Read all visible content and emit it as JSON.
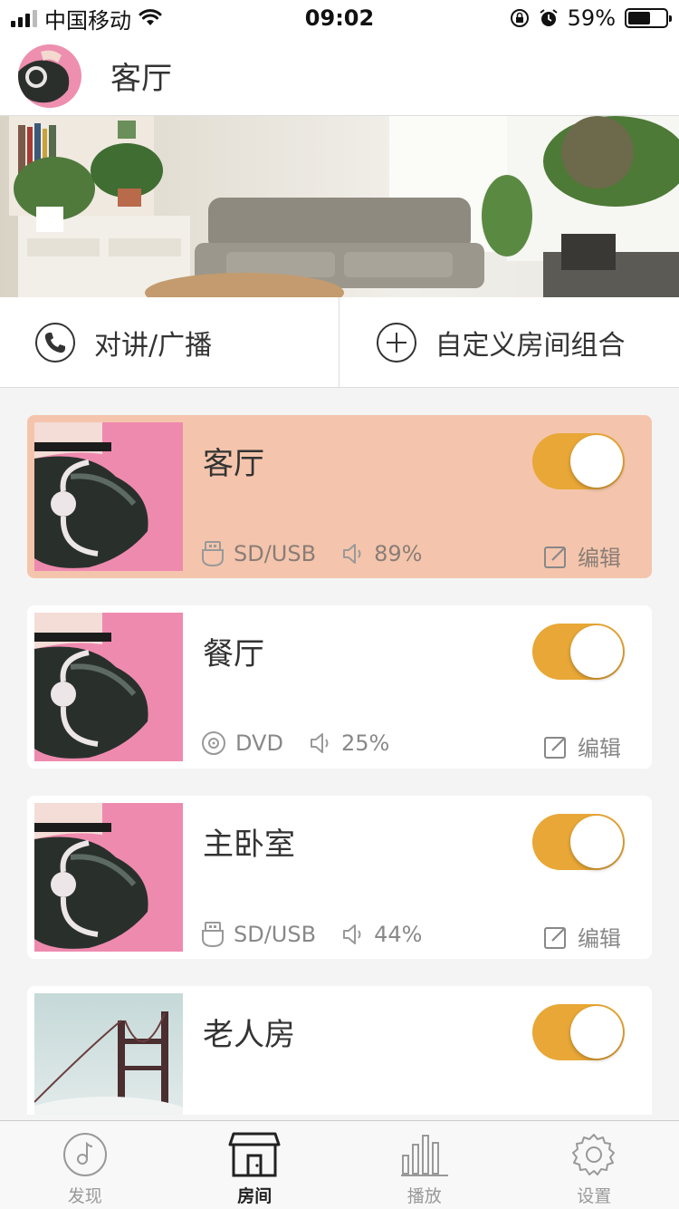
{
  "status_bar": {
    "carrier": "中国移动",
    "time": "09:02",
    "battery_percent": "59%"
  },
  "header": {
    "title": "客厅"
  },
  "actions": {
    "intercom_label": "对讲/广播",
    "custom_group_label": "自定义房间组合"
  },
  "rooms": [
    {
      "name": "客厅",
      "source": "SD/USB",
      "source_icon": "usb-icon",
      "volume": "89%",
      "edit_label": "编辑",
      "enabled": true,
      "active": true
    },
    {
      "name": "餐厅",
      "source": "DVD",
      "source_icon": "disc-icon",
      "volume": "25%",
      "edit_label": "编辑",
      "enabled": true,
      "active": false
    },
    {
      "name": "主卧室",
      "source": "SD/USB",
      "source_icon": "usb-icon",
      "volume": "44%",
      "edit_label": "编辑",
      "enabled": true,
      "active": false
    },
    {
      "name": "老人房",
      "enabled": true,
      "active": false
    }
  ],
  "tabbar": {
    "tabs": [
      {
        "label": "发现",
        "icon": "music-disc-icon"
      },
      {
        "label": "房间",
        "icon": "house-icon",
        "selected": true
      },
      {
        "label": "播放",
        "icon": "bars-icon"
      },
      {
        "label": "设置",
        "icon": "gear-icon"
      }
    ]
  },
  "colors": {
    "accent": "#e8a736",
    "active_card": "#f4c5ac"
  }
}
